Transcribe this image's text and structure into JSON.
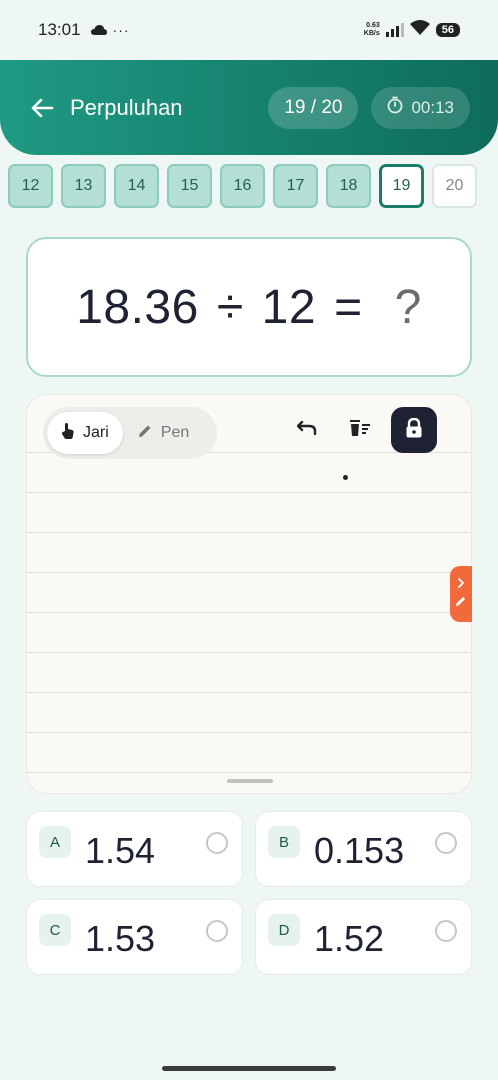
{
  "status_bar": {
    "time": "13:01",
    "dots": "···",
    "speed_value": "0.63",
    "speed_unit": "KB/s",
    "battery": "56"
  },
  "header": {
    "title": "Perpuluhan",
    "progress": "19 / 20",
    "timer": "00:13"
  },
  "question_tabs": [
    {
      "label": "12",
      "state": "answered"
    },
    {
      "label": "13",
      "state": "answered"
    },
    {
      "label": "14",
      "state": "answered"
    },
    {
      "label": "15",
      "state": "answered"
    },
    {
      "label": "16",
      "state": "answered"
    },
    {
      "label": "17",
      "state": "answered"
    },
    {
      "label": "18",
      "state": "answered"
    },
    {
      "label": "19",
      "state": "current"
    },
    {
      "label": "20",
      "state": "upcoming"
    }
  ],
  "question": {
    "operand1": "18.36",
    "operator": "÷",
    "operand2": "12",
    "equals": "=",
    "unknown": "?"
  },
  "scratchpad": {
    "modes": [
      {
        "label": "Jari",
        "icon": "finger-touch-icon",
        "active": true
      },
      {
        "label": "Pen",
        "icon": "pencil-icon",
        "active": false
      }
    ],
    "tools": [
      "undo-icon",
      "clear-icon",
      "lock-icon"
    ]
  },
  "options": [
    {
      "letter": "A",
      "value": "1.54"
    },
    {
      "letter": "B",
      "value": "0.153"
    },
    {
      "letter": "C",
      "value": "1.53"
    },
    {
      "letter": "D",
      "value": "1.52"
    }
  ],
  "colors": {
    "header_start": "#1f9a83",
    "header_end": "#0e6c5b",
    "accent_orange": "#f26a3c",
    "tab_answered": "#b4dfd4"
  }
}
